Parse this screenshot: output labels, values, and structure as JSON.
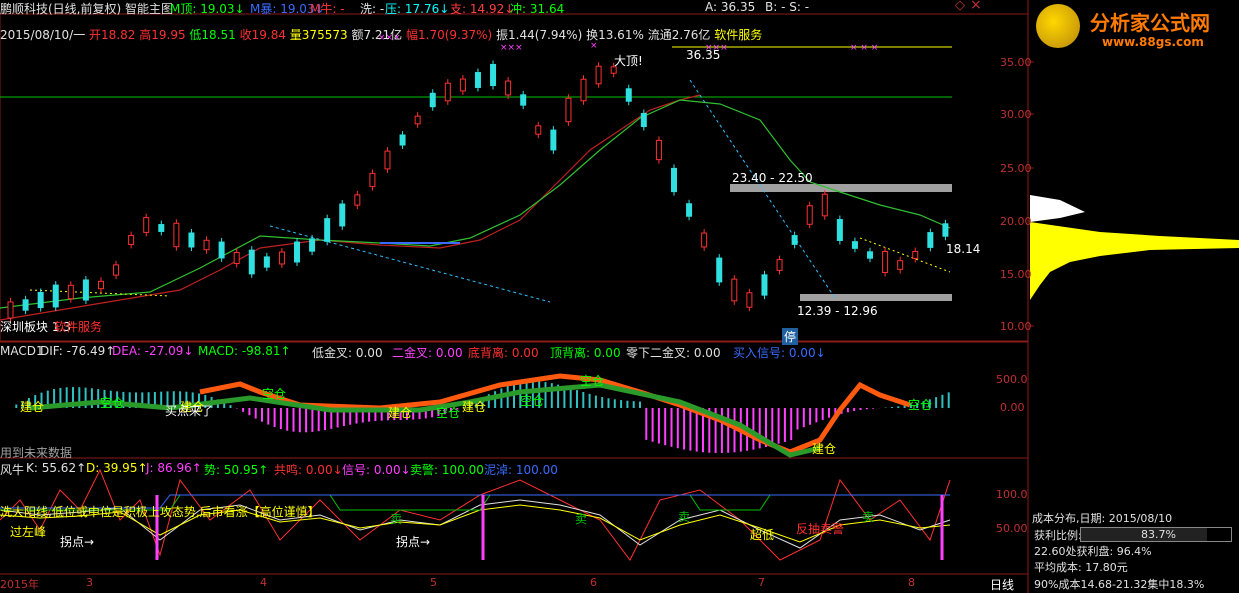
{
  "header": {
    "title": "鹏顺科技(日线,前复权) 智能主图",
    "indicators": [
      {
        "label": "M顶: 19.03",
        "color": "#00ff00",
        "arrow": "↓"
      },
      {
        "label": "M暴: 19.03",
        "color": "#3a6bff",
        "arrow": "↓"
      },
      {
        "label": "M牛: -",
        "color": "#ff3030",
        "arrow": ""
      },
      {
        "label": "洗: -",
        "color": "#e0e0e0",
        "arrow": ""
      },
      {
        "label": "压: 17.76",
        "color": "#00ffff",
        "arrow": "↓"
      },
      {
        "label": "支: 14.92",
        "color": "#ff4040",
        "arrow": "↓"
      },
      {
        "label": "冲: 31.64",
        "color": "#00ff00",
        "arrow": ""
      },
      {
        "label": "A: 36.35",
        "color": "#e0e0e0",
        "arrow": ""
      },
      {
        "label": "B: - S: -",
        "color": "#e0e0e0",
        "arrow": ""
      }
    ]
  },
  "info_line": {
    "date": "2015/08/10/一",
    "open": "开18.82",
    "high": "高19.95",
    "low": "低18.51",
    "close": "收19.84",
    "volume": "量375573",
    "amount": "额7.21亿",
    "change": "幅1.70(9.37%)",
    "amplitude": "振1.44(7.94%)",
    "turnover": "换13.61%",
    "float": "流通2.76亿",
    "service": "软件服务"
  },
  "main_chart": {
    "price_axis": [
      "35.00",
      "30.00",
      "25.00",
      "20.00",
      "15.00",
      "10.00"
    ],
    "annotations": {
      "top": "大顶!",
      "peak": "36.35",
      "resist_band": "23.40 - 22.50",
      "support_band": "12.39 - 12.96",
      "current": "18.14",
      "watermark": "深圳板块 1.3",
      "sector": "软件服务",
      "stop": "停"
    }
  },
  "macd_panel": {
    "legend": [
      {
        "label": "MACD1",
        "color": "#e0e0e0"
      },
      {
        "label": "DIF: -76.49↑",
        "color": "#e0e0e0"
      },
      {
        "label": "DEA: -27.09↓",
        "color": "#ff40ff"
      },
      {
        "label": "MACD: -98.81↑",
        "color": "#00ff00"
      },
      {
        "label": "低金叉: 0.00",
        "color": "#e0e0e0"
      },
      {
        "label": "二金叉: 0.00",
        "color": "#ff40ff"
      },
      {
        "label": "底背离: 0.00",
        "color": "#ff3030"
      },
      {
        "label": "顶背离: 0.00",
        "color": "#00ff00"
      },
      {
        "label": "零下二金叉: 0.00",
        "color": "#e0e0e0"
      },
      {
        "label": "买入信号: 0.00↓",
        "color": "#3a6bff"
      }
    ],
    "axis": [
      "500.0",
      "0.00"
    ],
    "signals": [
      "建仓",
      "空仓",
      "建仓",
      "买点来了",
      "空仓",
      "建仓",
      "空仓",
      "建仓",
      "空仓",
      "空仓",
      "建仓",
      "空仓"
    ],
    "note": "用到未来数据"
  },
  "kdj_panel": {
    "legend": [
      {
        "label": "风牛",
        "color": "#e0e0e0"
      },
      {
        "label": "K: 55.62↑",
        "color": "#e0e0e0"
      },
      {
        "label": "D: 39.95↑",
        "color": "#ffff00"
      },
      {
        "label": "J: 86.96↑",
        "color": "#ff40ff"
      },
      {
        "label": "势: 50.95↑",
        "color": "#00ff00"
      },
      {
        "label": "共鸣: 0.00↓",
        "color": "#ff3030"
      },
      {
        "label": "信号: 0.00↓",
        "color": "#ff40ff"
      },
      {
        "label": "卖警: 100.00",
        "color": "#00ff00"
      },
      {
        "label": "泥淖: 100.00",
        "color": "#3a6bff"
      }
    ],
    "axis": [
      "100.0",
      "50.00"
    ],
    "note_banner": "洗大阳线,低位或中位是积极上攻态势,后市看涨【高位谨慎】",
    "labels": {
      "a": "过左峰",
      "b": "拐点→",
      "c": "拐点→",
      "d": "超低",
      "e": "反抽卖警",
      "f": "卖",
      "g": "卖",
      "h": "卖",
      "i": "卖"
    }
  },
  "date_axis": [
    "2015年",
    "3",
    "4",
    "5",
    "6",
    "7",
    "8"
  ],
  "period_tab": "日线",
  "cost_panel": {
    "title": "成本分布,日期: 2015/08/10",
    "profit_ratio_label": "获利比例:",
    "profit_ratio_value": "83.7%",
    "profit_ratio": 0.837,
    "profit_at": "22.60处获利盘: 96.4%",
    "avg_cost": "平均成本: 17.80元",
    "concentration": "90%成本14.68-21.32集中18.3%"
  },
  "logo": {
    "text": "分析家公式网",
    "url": "www.88gs.com"
  },
  "window_controls": {
    "icon": "diamond-icon",
    "close": "×"
  }
}
